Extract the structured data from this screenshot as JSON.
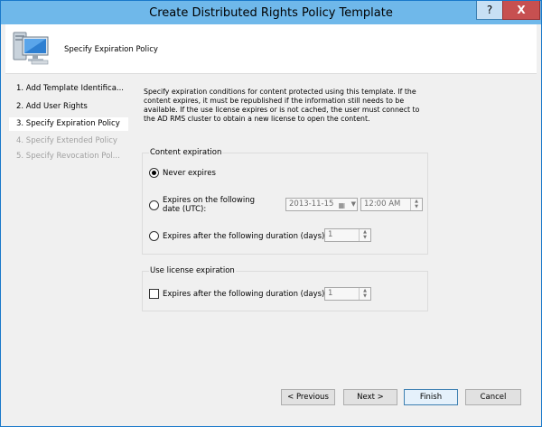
{
  "window": {
    "title": "Create Distributed Rights Policy Template",
    "help_label": "?",
    "close_label": "X"
  },
  "header": {
    "step_title": "Specify Expiration Policy",
    "icon": "computer-icon"
  },
  "nav": {
    "items": [
      {
        "label": "1. Add Template Identifica...",
        "state": "normal"
      },
      {
        "label": "2. Add User Rights",
        "state": "normal"
      },
      {
        "label": "3. Specify Expiration Policy",
        "state": "active"
      },
      {
        "label": "4. Specify Extended Policy",
        "state": "disabled"
      },
      {
        "label": "5. Specify Revocation Pol...",
        "state": "disabled"
      }
    ]
  },
  "main": {
    "description": "Specify expiration conditions for content protected using this template. If the content expires, it must be republished if the information still needs to be available. If the use license expires or is not cached, the user must connect to the AD RMS cluster to obtain a new license to open the content.",
    "content_expiration": {
      "title": "Content expiration",
      "never_expires": "Never expires",
      "expires_on_date": "Expires on the following date (UTC):",
      "date_value": "2013-11-15",
      "time_value": "12:00 AM",
      "expires_after_duration": "Expires after the following duration (days):",
      "duration_value": "1",
      "selected": "never_expires"
    },
    "use_license": {
      "title": "Use license expiration",
      "expires_after_duration": "Expires after the following duration (days):",
      "duration_value": "1",
      "checked": false
    }
  },
  "footer": {
    "previous": "< Previous",
    "next": "Next >",
    "finish": "Finish",
    "cancel": "Cancel"
  }
}
